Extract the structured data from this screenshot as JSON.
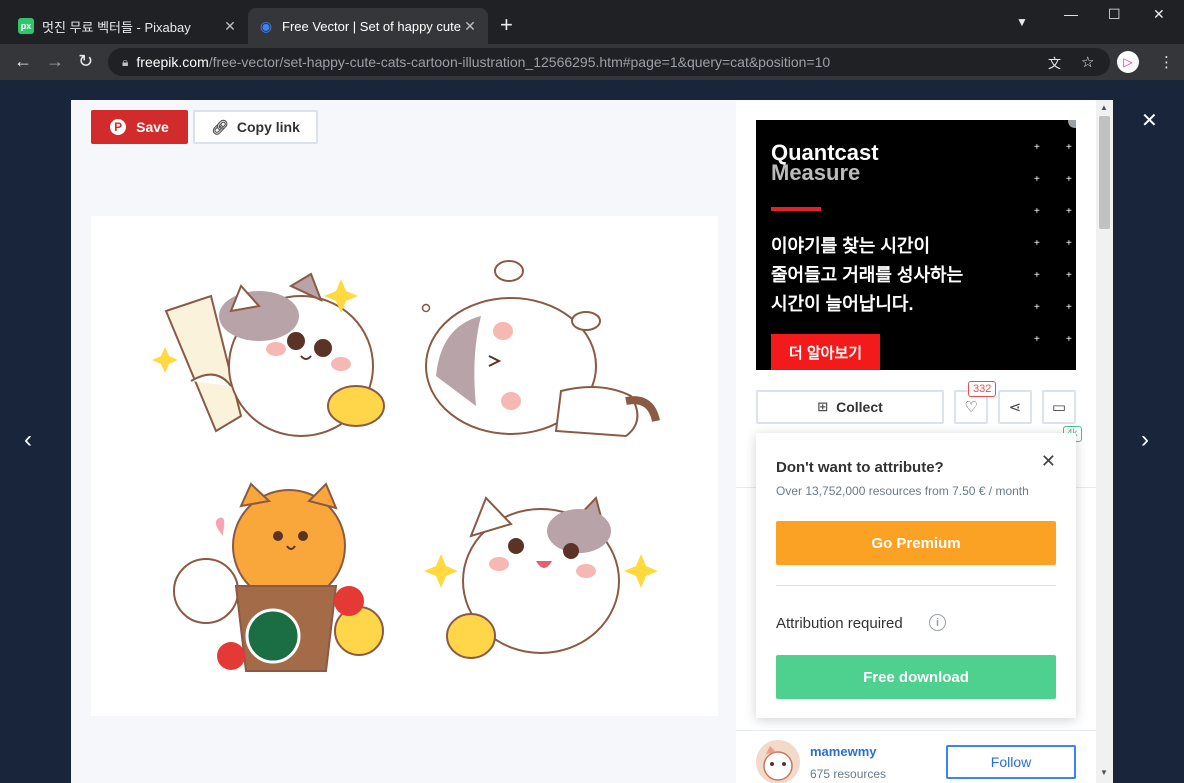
{
  "browser": {
    "tabs": [
      {
        "favicon": "px",
        "title": "멋진 무료 벡터들 - Pixabay",
        "active": false
      },
      {
        "favicon": "freepik-icon",
        "title": "Free Vector | Set of happy cute",
        "active": true
      }
    ],
    "url_host": "freepik.com",
    "url_path": "/free-vector/set-happy-cute-cats-cartoon-illustration_12566295.htm#page=1&query=cat&position=10"
  },
  "toolbar": {
    "save_label": "Save",
    "copy_link_label": "Copy link"
  },
  "ad": {
    "brand_line1": "Quantcast",
    "brand_line2": "Measure",
    "text_lines": [
      "이야기를 찾는 시간이",
      "줄어들고 거래를 성사하는",
      "시간이 늘어납니다."
    ],
    "cta": "더 알아보기"
  },
  "actions": {
    "collect_label": "Collect",
    "likes_count": "332",
    "comments_badge": "4k"
  },
  "popover": {
    "heading": "Don't want to attribute?",
    "subtext": "Over 13,752,000 resources from 7.50 € / month",
    "premium_label": "Go Premium",
    "attribution_label": "Attribution required",
    "free_download_label": "Free download"
  },
  "author": {
    "name": "mamewmy",
    "resources": "675 resources",
    "follow_label": "Follow"
  },
  "colors": {
    "save_red": "#d12b2b",
    "premium_orange": "#fba124",
    "free_green": "#4ed08f",
    "follow_blue": "#3b82f6"
  }
}
